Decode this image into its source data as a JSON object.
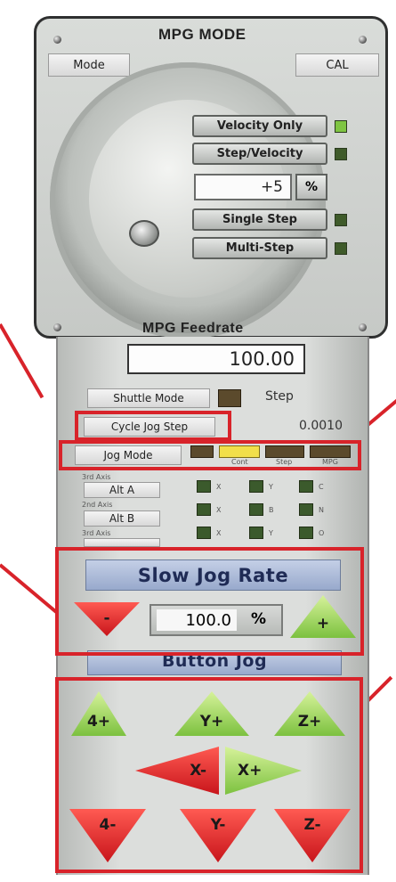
{
  "mpg": {
    "title": "MPG MODE",
    "mode_label": "Mode",
    "cal_label": "CAL",
    "velocity_only_label": "Velocity Only",
    "step_velocity_label": "Step/Velocity",
    "step_value": "+5",
    "step_unit": "%",
    "single_step_label": "Single Step",
    "multi_step_label": "Multi-Step",
    "feedrate_title": "MPG Feedrate"
  },
  "feedrate": {
    "value": "100.00"
  },
  "jog": {
    "shuttle_mode_label": "Shuttle Mode",
    "step_label": "Step",
    "cycle_jog_step_label": "Cycle Jog Step",
    "jog_step_value": "0.0010",
    "jog_mode_label": "Jog Mode",
    "mode_indicators": [
      "Cont",
      "Step",
      "MPG"
    ],
    "alt_a_caption": "3rd Axis",
    "alt_a_label": "Alt A",
    "alt_b_caption": "2nd Axis",
    "alt_b_label": "Alt B",
    "alt_c_caption": "3rd Axis",
    "axis_col1": [
      "X",
      "X",
      "X"
    ],
    "axis_col2": [
      "Y",
      "B",
      "Y"
    ],
    "axis_col3": [
      "C",
      "N",
      "O"
    ]
  },
  "slow_jog": {
    "title": "Slow Jog Rate",
    "minus_label": "-",
    "value": "100.0",
    "unit": "%",
    "plus_label": "+"
  },
  "button_jog": {
    "title": "Button Jog",
    "a_plus": "4+",
    "y_plus": "Y+",
    "z_plus": "Z+",
    "x_minus": "X-",
    "x_plus": "X+",
    "a_minus": "4-",
    "y_minus": "Y-",
    "z_minus": "Z-"
  },
  "colors": {
    "annotation": "#d8232a",
    "led_on": "#7fc542",
    "led_off": "#3f5b2a",
    "jog_plus": "#7cc13f",
    "jog_minus": "#c8151b"
  }
}
